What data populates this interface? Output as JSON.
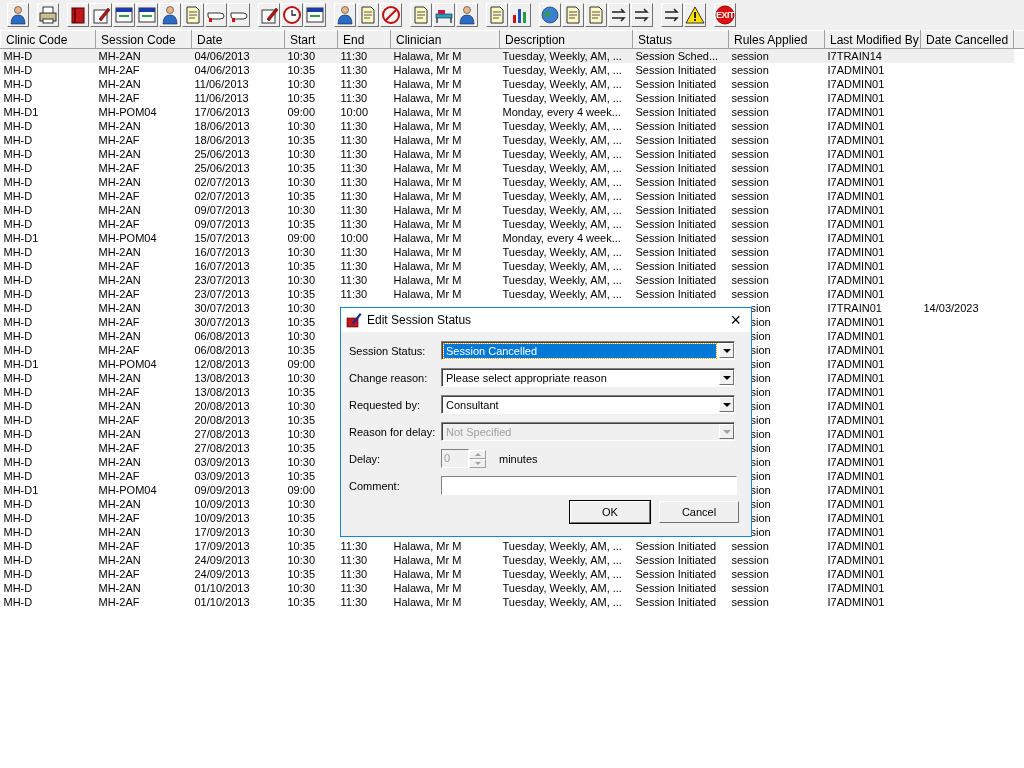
{
  "toolbar": {
    "exit_label": "EXIT"
  },
  "table": {
    "columns": [
      "Clinic Code",
      "Session Code",
      "Date",
      "Start",
      "End",
      "Clinician",
      "Description",
      "Status",
      "Rules Applied",
      "Last Modified By",
      "Date Cancelled"
    ],
    "rows": [
      {
        "selected": true,
        "cells": [
          "MH-D",
          "MH-2AN",
          "04/06/2013",
          "10:30",
          "11:30",
          "Halawa, Mr M",
          "Tuesday, Weekly, AM, ...",
          "Session Sched...",
          "session",
          "I7TRAIN14",
          null
        ]
      },
      {
        "selected": false,
        "cells": [
          "MH-D",
          "MH-2AF",
          "04/06/2013",
          "10:35",
          "11:30",
          "Halawa, Mr M",
          "Tuesday, Weekly, AM, ...",
          "Session Initiated",
          "session",
          "I7ADMIN01",
          null
        ]
      },
      {
        "selected": false,
        "cells": [
          "MH-D",
          "MH-2AN",
          "11/06/2013",
          "10:30",
          "11:30",
          "Halawa, Mr M",
          "Tuesday, Weekly, AM, ...",
          "Session Initiated",
          "session",
          "I7ADMIN01",
          null
        ]
      },
      {
        "selected": false,
        "cells": [
          "MH-D",
          "MH-2AF",
          "11/06/2013",
          "10:35",
          "11:30",
          "Halawa, Mr M",
          "Tuesday, Weekly, AM, ...",
          "Session Initiated",
          "session",
          "I7ADMIN01",
          null
        ]
      },
      {
        "selected": false,
        "cells": [
          "MH-D1",
          "MH-POM04",
          "17/06/2013",
          "09:00",
          "10:00",
          "Halawa, Mr M",
          "Monday, every 4 week...",
          "Session Initiated",
          "session",
          "I7ADMIN01",
          null
        ]
      },
      {
        "selected": false,
        "cells": [
          "MH-D",
          "MH-2AN",
          "18/06/2013",
          "10:30",
          "11:30",
          "Halawa, Mr M",
          "Tuesday, Weekly, AM, ...",
          "Session Initiated",
          "session",
          "I7ADMIN01",
          null
        ]
      },
      {
        "selected": false,
        "cells": [
          "MH-D",
          "MH-2AF",
          "18/06/2013",
          "10:35",
          "11:30",
          "Halawa, Mr M",
          "Tuesday, Weekly, AM, ...",
          "Session Initiated",
          "session",
          "I7ADMIN01",
          null
        ]
      },
      {
        "selected": false,
        "cells": [
          "MH-D",
          "MH-2AN",
          "25/06/2013",
          "10:30",
          "11:30",
          "Halawa, Mr M",
          "Tuesday, Weekly, AM, ...",
          "Session Initiated",
          "session",
          "I7ADMIN01",
          null
        ]
      },
      {
        "selected": false,
        "cells": [
          "MH-D",
          "MH-2AF",
          "25/06/2013",
          "10:35",
          "11:30",
          "Halawa, Mr M",
          "Tuesday, Weekly, AM, ...",
          "Session Initiated",
          "session",
          "I7ADMIN01",
          null
        ]
      },
      {
        "selected": false,
        "cells": [
          "MH-D",
          "MH-2AN",
          "02/07/2013",
          "10:30",
          "11:30",
          "Halawa, Mr M",
          "Tuesday, Weekly, AM, ...",
          "Session Initiated",
          "session",
          "I7ADMIN01",
          null
        ]
      },
      {
        "selected": false,
        "cells": [
          "MH-D",
          "MH-2AF",
          "02/07/2013",
          "10:35",
          "11:30",
          "Halawa, Mr M",
          "Tuesday, Weekly, AM, ...",
          "Session Initiated",
          "session",
          "I7ADMIN01",
          null
        ]
      },
      {
        "selected": false,
        "cells": [
          "MH-D",
          "MH-2AN",
          "09/07/2013",
          "10:30",
          "11:30",
          "Halawa, Mr M",
          "Tuesday, Weekly, AM, ...",
          "Session Initiated",
          "session",
          "I7ADMIN01",
          null
        ]
      },
      {
        "selected": false,
        "cells": [
          "MH-D",
          "MH-2AF",
          "09/07/2013",
          "10:35",
          "11:30",
          "Halawa, Mr M",
          "Tuesday, Weekly, AM, ...",
          "Session Initiated",
          "session",
          "I7ADMIN01",
          null
        ]
      },
      {
        "selected": false,
        "cells": [
          "MH-D1",
          "MH-POM04",
          "15/07/2013",
          "09:00",
          "10:00",
          "Halawa, Mr M",
          "Monday, every 4 week...",
          "Session Initiated",
          "session",
          "I7ADMIN01",
          null
        ]
      },
      {
        "selected": false,
        "cells": [
          "MH-D",
          "MH-2AN",
          "16/07/2013",
          "10:30",
          "11:30",
          "Halawa, Mr M",
          "Tuesday, Weekly, AM, ...",
          "Session Initiated",
          "session",
          "I7ADMIN01",
          null
        ]
      },
      {
        "selected": false,
        "cells": [
          "MH-D",
          "MH-2AF",
          "16/07/2013",
          "10:35",
          "11:30",
          "Halawa, Mr M",
          "Tuesday, Weekly, AM, ...",
          "Session Initiated",
          "session",
          "I7ADMIN01",
          null
        ]
      },
      {
        "selected": false,
        "cells": [
          "MH-D",
          "MH-2AN",
          "23/07/2013",
          "10:30",
          "11:30",
          "Halawa, Mr M",
          "Tuesday, Weekly, AM, ...",
          "Session Initiated",
          "session",
          "I7ADMIN01",
          null
        ]
      },
      {
        "selected": false,
        "cells": [
          "MH-D",
          "MH-2AF",
          "23/07/2013",
          "10:35",
          "11:30",
          "Halawa, Mr M",
          "Tuesday, Weekly, AM, ...",
          "Session Initiated",
          "session",
          "I7ADMIN01",
          null
        ]
      },
      {
        "selected": false,
        "cells": [
          "MH-D",
          "MH-2AN",
          "30/07/2013",
          "10:30",
          null,
          null,
          null,
          null,
          "sion",
          "I7TRAIN01",
          "14/03/2023"
        ]
      },
      {
        "selected": false,
        "cells": [
          "MH-D",
          "MH-2AF",
          "30/07/2013",
          "10:35",
          null,
          null,
          null,
          null,
          "sion",
          "I7ADMIN01",
          null
        ]
      },
      {
        "selected": false,
        "cells": [
          "MH-D",
          "MH-2AN",
          "06/08/2013",
          "10:30",
          null,
          null,
          null,
          null,
          "sion",
          "I7ADMIN01",
          null
        ]
      },
      {
        "selected": false,
        "cells": [
          "MH-D",
          "MH-2AF",
          "06/08/2013",
          "10:35",
          null,
          null,
          null,
          null,
          "sion",
          "I7ADMIN01",
          null
        ]
      },
      {
        "selected": false,
        "cells": [
          "MH-D1",
          "MH-POM04",
          "12/08/2013",
          "09:00",
          null,
          null,
          null,
          null,
          "sion",
          "I7ADMIN01",
          null
        ]
      },
      {
        "selected": false,
        "cells": [
          "MH-D",
          "MH-2AN",
          "13/08/2013",
          "10:30",
          null,
          null,
          null,
          null,
          "sion",
          "I7ADMIN01",
          null
        ]
      },
      {
        "selected": false,
        "cells": [
          "MH-D",
          "MH-2AF",
          "13/08/2013",
          "10:35",
          null,
          null,
          null,
          null,
          "sion",
          "I7ADMIN01",
          null
        ]
      },
      {
        "selected": false,
        "cells": [
          "MH-D",
          "MH-2AN",
          "20/08/2013",
          "10:30",
          null,
          null,
          null,
          null,
          "sion",
          "I7ADMIN01",
          null
        ]
      },
      {
        "selected": false,
        "cells": [
          "MH-D",
          "MH-2AF",
          "20/08/2013",
          "10:35",
          null,
          null,
          null,
          null,
          "sion",
          "I7ADMIN01",
          null
        ]
      },
      {
        "selected": false,
        "cells": [
          "MH-D",
          "MH-2AN",
          "27/08/2013",
          "10:30",
          null,
          null,
          null,
          null,
          "sion",
          "I7ADMIN01",
          null
        ]
      },
      {
        "selected": false,
        "cells": [
          "MH-D",
          "MH-2AF",
          "27/08/2013",
          "10:35",
          null,
          null,
          null,
          null,
          "sion",
          "I7ADMIN01",
          null
        ]
      },
      {
        "selected": false,
        "cells": [
          "MH-D",
          "MH-2AN",
          "03/09/2013",
          "10:30",
          null,
          null,
          null,
          null,
          "sion",
          "I7ADMIN01",
          null
        ]
      },
      {
        "selected": false,
        "cells": [
          "MH-D",
          "MH-2AF",
          "03/09/2013",
          "10:35",
          null,
          null,
          null,
          null,
          "sion",
          "I7ADMIN01",
          null
        ]
      },
      {
        "selected": false,
        "cells": [
          "MH-D1",
          "MH-POM04",
          "09/09/2013",
          "09:00",
          null,
          null,
          null,
          null,
          "sion",
          "I7ADMIN01",
          null
        ]
      },
      {
        "selected": false,
        "cells": [
          "MH-D",
          "MH-2AN",
          "10/09/2013",
          "10:30",
          null,
          null,
          null,
          null,
          "sion",
          "I7ADMIN01",
          null
        ]
      },
      {
        "selected": false,
        "cells": [
          "MH-D",
          "MH-2AF",
          "10/09/2013",
          "10:35",
          null,
          null,
          null,
          null,
          "sion",
          "I7ADMIN01",
          null
        ]
      },
      {
        "selected": false,
        "cells": [
          "MH-D",
          "MH-2AN",
          "17/09/2013",
          "10:30",
          null,
          null,
          null,
          null,
          "sion",
          "I7ADMIN01",
          null
        ]
      },
      {
        "selected": false,
        "cells": [
          "MH-D",
          "MH-2AF",
          "17/09/2013",
          "10:35",
          "11:30",
          "Halawa, Mr M",
          "Tuesday, Weekly, AM, ...",
          "Session Initiated",
          "session",
          "I7ADMIN01",
          null
        ]
      },
      {
        "selected": false,
        "cells": [
          "MH-D",
          "MH-2AN",
          "24/09/2013",
          "10:30",
          "11:30",
          "Halawa, Mr M",
          "Tuesday, Weekly, AM, ...",
          "Session Initiated",
          "session",
          "I7ADMIN01",
          null
        ]
      },
      {
        "selected": false,
        "cells": [
          "MH-D",
          "MH-2AF",
          "24/09/2013",
          "10:35",
          "11:30",
          "Halawa, Mr M",
          "Tuesday, Weekly, AM, ...",
          "Session Initiated",
          "session",
          "I7ADMIN01",
          null
        ]
      },
      {
        "selected": false,
        "cells": [
          "MH-D",
          "MH-2AN",
          "01/10/2013",
          "10:30",
          "11:30",
          "Halawa, Mr M",
          "Tuesday, Weekly, AM, ...",
          "Session Initiated",
          "session",
          "I7ADMIN01",
          null
        ]
      },
      {
        "selected": false,
        "cells": [
          "MH-D",
          "MH-2AF",
          "01/10/2013",
          "10:35",
          "11:30",
          "Halawa, Mr M",
          "Tuesday, Weekly, AM, ...",
          "Session Initiated",
          "session",
          "I7ADMIN01",
          null
        ]
      }
    ]
  },
  "dialog": {
    "title": "Edit Session Status",
    "close": "×",
    "fields": [
      {
        "kind": "select",
        "label": "Session Status:",
        "value": "Session Cancelled",
        "focused": true,
        "disabled": false
      },
      {
        "kind": "select",
        "label": "Change reason:",
        "value": "Please select appropriate reason",
        "focused": false,
        "disabled": false
      },
      {
        "kind": "select",
        "label": "Requested by:",
        "value": "Consultant",
        "focused": false,
        "disabled": false
      },
      {
        "kind": "select",
        "label": "Reason for delay:",
        "value": "Not Specified",
        "focused": false,
        "disabled": true
      },
      {
        "kind": "spinner",
        "label": "Delay:",
        "value": "0",
        "unit": "minutes",
        "disabled": true
      },
      {
        "kind": "text",
        "label": "Comment:"
      }
    ],
    "buttons": [
      {
        "label": "OK",
        "default": true
      },
      {
        "label": "Cancel",
        "default": false
      }
    ]
  }
}
